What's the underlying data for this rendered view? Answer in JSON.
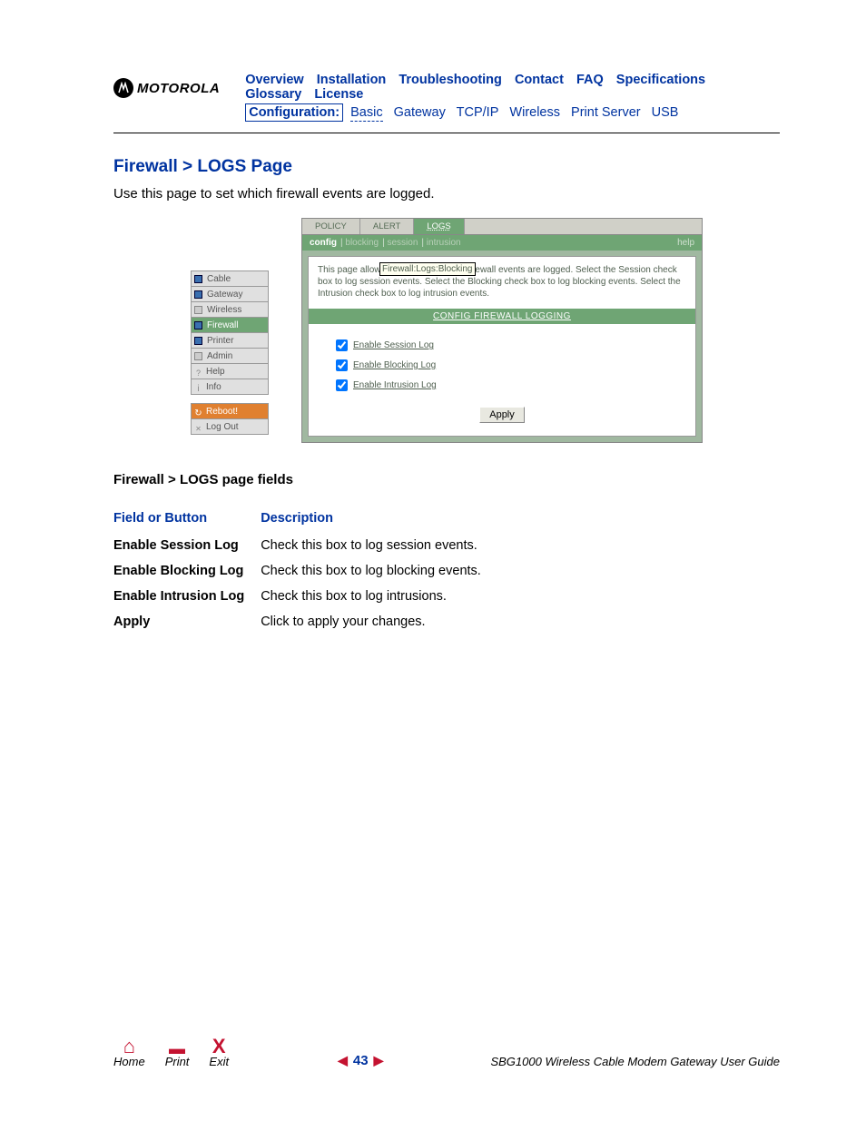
{
  "brand": "MOTOROLA",
  "topNav": [
    "Overview",
    "Installation",
    "Troubleshooting",
    "Contact",
    "FAQ",
    "Specifications",
    "Glossary",
    "License"
  ],
  "subNav": {
    "label": "Configuration:",
    "links": [
      "Basic",
      "Gateway",
      "TCP/IP",
      "Wireless",
      "Print Server",
      "USB"
    ]
  },
  "page": {
    "title": "Firewall > LOGS Page",
    "intro": "Use this page to set which firewall events are logged."
  },
  "sidebar": [
    "Cable",
    "Gateway",
    "Wireless",
    "Firewall",
    "Printer",
    "Admin",
    "Help",
    "Info"
  ],
  "sidebarReboot": "Reboot!",
  "sidebarLogout": "Log Out",
  "tabs": [
    "POLICY",
    "ALERT",
    "LOGS"
  ],
  "activeTab": 2,
  "subtabs": [
    "config",
    "blocking",
    "session",
    "intrusion"
  ],
  "subtabHelp": "help",
  "tooltip": "Firewall:Logs:Blocking",
  "paneDesc1": "This page allow",
  "paneDesc2": " firewall events are logged. Select the Session check box to log session events. Select the Blocking check box to log blocking events. Select the Intrusion check box to log intrusion events.",
  "configBanner": "CONFIG FIREWALL LOGGING",
  "checks": [
    "Enable Session Log",
    "Enable Blocking Log",
    "Enable Intrusion Log"
  ],
  "applyLabel": "Apply",
  "fieldsTitle": "Firewall > LOGS page fields",
  "tableHeaders": [
    "Field or Button",
    "Description"
  ],
  "tableRows": [
    {
      "f": "Enable Session Log",
      "d": "Check this box to log session events."
    },
    {
      "f": "Enable Blocking Log",
      "d": "Check this box to log blocking events."
    },
    {
      "f": "Enable Intrusion Log",
      "d": "Check this box to log intrusions."
    },
    {
      "f": "Apply",
      "d": "Click to apply your changes."
    }
  ],
  "footer": {
    "home": "Home",
    "print": "Print",
    "exit": "Exit",
    "pageNum": "43",
    "guide": "SBG1000 Wireless Cable Modem Gateway User Guide"
  }
}
